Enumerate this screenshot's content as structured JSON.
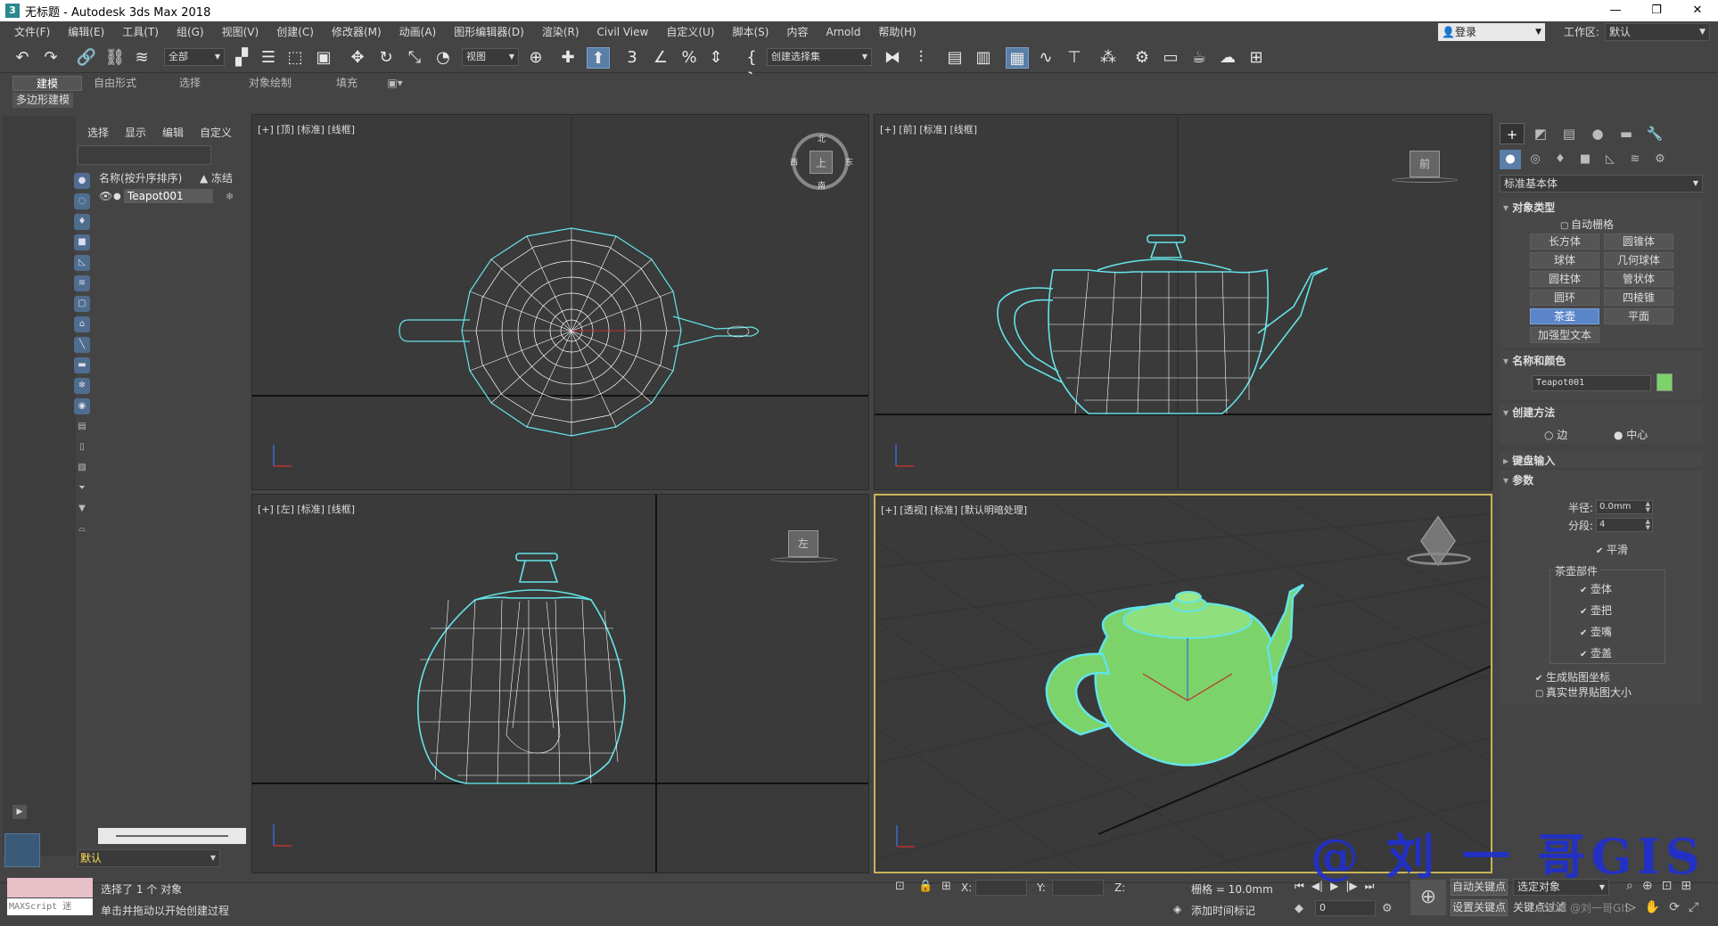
{
  "window": {
    "title": "无标题 - Autodesk 3ds Max 2018",
    "app_icon": "3",
    "min": "—",
    "restore": "❐",
    "close": "✕"
  },
  "menu": [
    "文件(F)",
    "编辑(E)",
    "工具(T)",
    "组(G)",
    "视图(V)",
    "创建(C)",
    "修改器(M)",
    "动画(A)",
    "图形编辑器(D)",
    "渲染(R)",
    "Civil View",
    "自定义(U)",
    "脚本(S)",
    "内容",
    "Arnold",
    "帮助(H)"
  ],
  "account": {
    "login": "登录",
    "workspace_label": "工作区:",
    "workspace_value": "默认"
  },
  "toolbar": {
    "filter": "全部",
    "refcoord": "视图",
    "named_sel": "创建选择集"
  },
  "ribbon": {
    "tabs": [
      "建模",
      "自由形式",
      "选择",
      "对象绘制",
      "填充"
    ],
    "sub": "多边形建模"
  },
  "scene": {
    "tabs": [
      "选择",
      "显示",
      "编辑",
      "自定义"
    ],
    "col_name": "名称(按升序排序)",
    "col_freeze": "▲ 冻结",
    "row_name": "Teapot001",
    "layer": "默认"
  },
  "viewports": {
    "top": "[+] [顶] [标准] [线框]",
    "front": "[+] [前] [标准] [线框]",
    "left": "[+] [左] [标准] [线框]",
    "persp": "[+] [透视] [标准] [默认明暗处理]"
  },
  "viewcube": {
    "top": "上",
    "north": "北",
    "south": "南",
    "west": "西",
    "east": "东",
    "front": "前",
    "left": "左"
  },
  "command_panel": {
    "dropdown": "标准基本体",
    "object_type": "对象类型",
    "autogrid": "自动栅格",
    "buttons": [
      "长方体",
      "圆锥体",
      "球体",
      "几何球体",
      "圆柱体",
      "管状体",
      "圆环",
      "四棱锥",
      "茶壶",
      "平面",
      "加强型文本"
    ],
    "active_button": "茶壶",
    "name_color": "名称和颜色",
    "object_name": "Teapot001",
    "object_color": "#7bd36a",
    "creation_method": "创建方法",
    "edge": "边",
    "center": "中心",
    "keyboard_entry": "键盘输入",
    "params": "参数",
    "radius_label": "半径:",
    "radius_value": "0.0mm",
    "segments_label": "分段:",
    "segments_value": "4",
    "smooth": "平滑",
    "parts_title": "茶壶部件",
    "parts": [
      "壶体",
      "壶把",
      "壶嘴",
      "壶盖"
    ],
    "gen_map": "生成贴图坐标",
    "real_world": "真实世界贴图大小"
  },
  "status": {
    "maxscript": "MAXScript 迷",
    "line1": "选择了 1 个 对象",
    "line2": "单击并拖动以开始创建过程",
    "x": "X:",
    "y": "Y:",
    "z": "Z:",
    "grid": "栅格 = 10.0mm",
    "add_time_tag": "添加时间标记",
    "frame": "0",
    "autokey": "自动关键点",
    "setkey": "设置关键点",
    "selected": "选定对象",
    "keyfilter": "关键点过滤",
    "csdn": "CSDN @刘一哥GIS"
  },
  "watermark": "@ 刘 一 哥GIS",
  "colors": {
    "wire_selected": "#64e3e8",
    "teapot": "#7bd36a",
    "accent": "#5a86c9"
  }
}
